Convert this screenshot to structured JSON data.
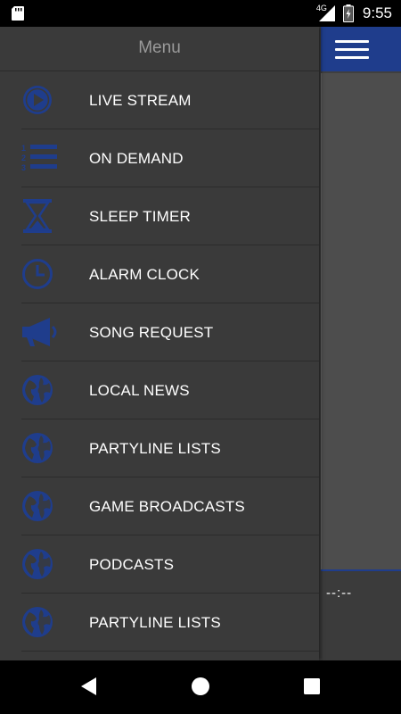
{
  "status_bar": {
    "network": "4G",
    "time": "9:55"
  },
  "drawer": {
    "title": "Menu",
    "items": [
      {
        "label": "LIVE STREAM",
        "icon": "play-circle-icon"
      },
      {
        "label": "ON DEMAND",
        "icon": "numbered-list-icon"
      },
      {
        "label": "SLEEP TIMER",
        "icon": "hourglass-icon"
      },
      {
        "label": "ALARM CLOCK",
        "icon": "clock-icon"
      },
      {
        "label": "SONG REQUEST",
        "icon": "megaphone-icon"
      },
      {
        "label": "LOCAL NEWS",
        "icon": "globe-icon"
      },
      {
        "label": "PARTYLINE LISTS",
        "icon": "globe-icon"
      },
      {
        "label": "GAME BROADCASTS",
        "icon": "globe-icon"
      },
      {
        "label": "PODCASTS",
        "icon": "globe-icon"
      },
      {
        "label": "PARTYLINE LISTS",
        "icon": "globe-icon"
      }
    ]
  },
  "player": {
    "time_display": "--:--"
  },
  "colors": {
    "accent": "#1f3d8c",
    "drawer_bg": "#3a3a3a",
    "icon": "#1f3d8c"
  }
}
